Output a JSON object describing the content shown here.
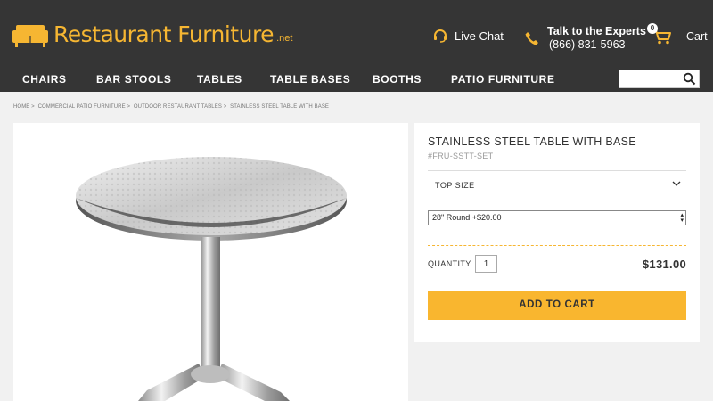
{
  "brand": {
    "name": "Restaurant Furniture",
    "suffix": ".net",
    "color": "#f6b632"
  },
  "header": {
    "live_chat": "Live Chat",
    "experts_title": "Talk to the Experts",
    "experts_phone": "(866) 831-5963",
    "cart_label": "Cart",
    "cart_count": "0"
  },
  "nav": {
    "items": [
      {
        "label": "CHAIRS"
      },
      {
        "label": "BAR STOOLS"
      },
      {
        "label": "TABLES"
      },
      {
        "label": "TABLE BASES"
      },
      {
        "label": "BOOTHS"
      },
      {
        "label": "PATIO FURNITURE"
      }
    ],
    "search_placeholder": ""
  },
  "breadcrumb": [
    "HOME >",
    "COMMERCIAL PATIO FURNITURE >",
    "OUTDOOR RESTAURANT TABLES >",
    "STAINLESS STEEL TABLE WITH BASE"
  ],
  "product": {
    "title": "STAINLESS STEEL TABLE WITH BASE",
    "sku": "#FRU-SSTT-SET",
    "option_label": "TOP SIZE",
    "selected_option": "28\" Round +$20.00",
    "quantity_label": "QUANTITY",
    "quantity_value": "1",
    "price": "$131.00",
    "add_to_cart": "ADD TO CART"
  },
  "colors": {
    "header_bg": "#353535",
    "accent": "#f9b62f",
    "page_bg": "#f1f1f1"
  }
}
